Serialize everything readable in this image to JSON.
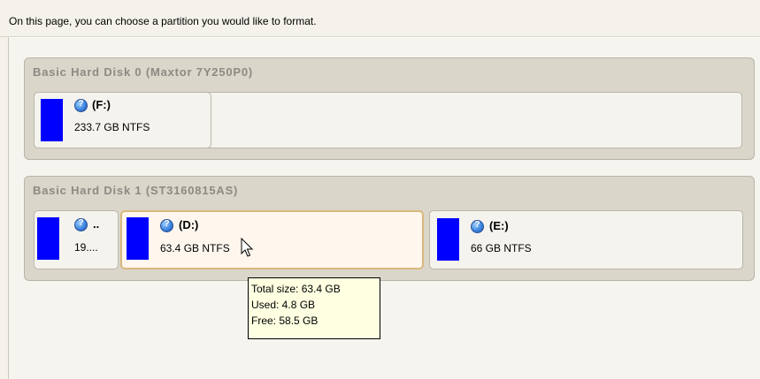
{
  "instruction": "On this page, you can choose a partition you would like to format.",
  "disks": [
    {
      "title": "Basic Hard Disk 0 (Maxtor 7Y250P0)",
      "partitions": [
        {
          "letter": "(F:)",
          "size": "233.7 GB NTFS",
          "selected": false
        }
      ]
    },
    {
      "title": "Basic Hard Disk 1 (ST3160815AS)",
      "partitions": [
        {
          "letter": "..",
          "size": "19....",
          "selected": false
        },
        {
          "letter": "(D:)",
          "size": "63.4 GB NTFS",
          "selected": true
        },
        {
          "letter": "(E:)",
          "size": "66 GB NTFS",
          "selected": false
        }
      ]
    }
  ],
  "tooltip": {
    "total": "Total size: 63.4 GB",
    "used": "Used: 4.8 GB",
    "free": "Free: 58.5 GB"
  },
  "colors": {
    "partition_fill": "#0000ff",
    "selected_border": "#d9b87d",
    "tooltip_bg": "#ffffe1"
  },
  "icons": [
    "help-icon",
    "mouse-pointer-icon"
  ]
}
